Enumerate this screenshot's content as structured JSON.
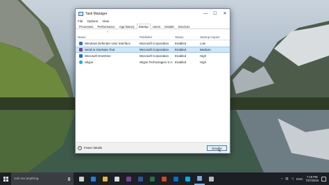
{
  "window": {
    "title": "Task Manager",
    "controls": {
      "minimize": "—",
      "maximize": "☐",
      "close": "✕"
    }
  },
  "menu": [
    "File",
    "Options",
    "View"
  ],
  "tabs": [
    "Processes",
    "Performance",
    "App history",
    "Startup",
    "Users",
    "Details",
    "Services"
  ],
  "active_tab": "Startup",
  "columns": {
    "name": "Name",
    "publisher": "Publisher",
    "status": "Status",
    "impact": "Startup impact"
  },
  "rows": [
    {
      "name": "Windows Defender User Interface",
      "publisher": "Microsoft Corporation",
      "status": "Enabled",
      "impact": "Low",
      "icon": "defender-icon",
      "icon_color": "#3b6fb6"
    },
    {
      "name": "Send to OneNote Tool",
      "publisher": "Microsoft Corporation",
      "status": "Enabled",
      "impact": "Medium",
      "icon": "onenote-icon",
      "icon_color": "#7b3fa0"
    },
    {
      "name": "Microsoft OneDrive",
      "publisher": "Microsoft Corporation",
      "status": "Enabled",
      "impact": "High",
      "icon": "onedrive-icon",
      "icon_color": "#1f6fd1"
    },
    {
      "name": "Skype",
      "publisher": "Skype Technologies S.A.",
      "status": "Enabled",
      "impact": "High",
      "icon": "skype-icon",
      "icon_color": "#00aff0"
    }
  ],
  "selected_row": 1,
  "footer": {
    "fewer_details": "Fewer details",
    "disable_button": "Disable"
  },
  "taskbar": {
    "search_placeholder": "Ask me anything",
    "apps": [
      {
        "name": "task-view-icon",
        "color": "#cfcfcf"
      },
      {
        "name": "edge-icon",
        "color": "#2b7cd3"
      },
      {
        "name": "file-explorer-icon",
        "color": "#e8b53a"
      },
      {
        "name": "store-icon",
        "color": "#d9d9d9"
      },
      {
        "name": "onenote-icon",
        "color": "#7b3fa0"
      },
      {
        "name": "word-icon",
        "color": "#2b579a"
      },
      {
        "name": "excel-icon",
        "color": "#217346"
      },
      {
        "name": "powerpoint-icon",
        "color": "#d24726"
      },
      {
        "name": "outlook-icon",
        "color": "#0072c6"
      },
      {
        "name": "skype-icon",
        "color": "#00aff0"
      },
      {
        "name": "task-manager-icon",
        "color": "#7fa7d6"
      },
      {
        "name": "settings-icon",
        "color": "#bbbbbb"
      }
    ],
    "language": "ENG",
    "time": "7:18 PM",
    "date": "7/27/2015"
  }
}
